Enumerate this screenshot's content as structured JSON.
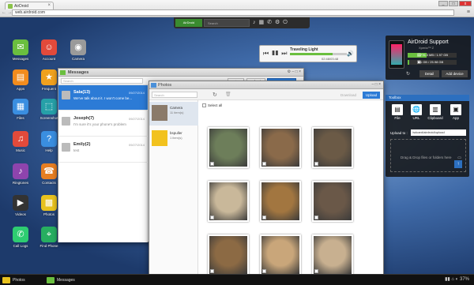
{
  "browser": {
    "tab_title": "AirDroid",
    "url": "web.airdroid.com",
    "nav_icons": "← → ↻",
    "menu_icon": "≡",
    "win_min": "_",
    "win_max": "□",
    "win_close": "x"
  },
  "topbar": {
    "logo": "AirDroid",
    "search_placeholder": "Search",
    "icons": [
      "bell-icon",
      "apps-icon",
      "phone-icon",
      "gear-icon",
      "power-icon"
    ]
  },
  "desktop_icons": [
    {
      "label": "Messages",
      "icon": "messages-icon",
      "color": "#6abf3f"
    },
    {
      "label": "Account",
      "icon": "account-icon",
      "color": "#e24a3b"
    },
    {
      "label": "Camera",
      "icon": "camera-icon",
      "color": "#9a9a9a"
    },
    {
      "label": "Apps",
      "icon": "apps-icon",
      "color": "#f28c1e"
    },
    {
      "label": "Frequent",
      "icon": "frequent-icon",
      "color": "#f0a11e"
    },
    {
      "label": "Files",
      "icon": "files-icon",
      "color": "#3a8ee0"
    },
    {
      "label": "Screenshot",
      "icon": "screenshot-icon",
      "color": "#26a0a8"
    },
    {
      "label": "Music",
      "icon": "music-icon",
      "color": "#e24a3b"
    },
    {
      "label": "Help",
      "icon": "help-icon",
      "color": "#3a8ee0"
    },
    {
      "label": "Ringtones",
      "icon": "ringtones-icon",
      "color": "#8e44ad"
    },
    {
      "label": "Contacts",
      "icon": "contacts-icon",
      "color": "#e67e22"
    },
    {
      "label": "Videos",
      "icon": "videos-icon",
      "color": "#333333"
    },
    {
      "label": "Photos",
      "icon": "photos-icon",
      "color": "#e8c21e"
    },
    {
      "label": "Call Logs",
      "icon": "calllogs-icon",
      "color": "#2ecc71"
    },
    {
      "label": "Find Phone",
      "icon": "findphone-icon",
      "color": "#27ae60"
    }
  ],
  "player": {
    "title": "Traveling Light",
    "time": "02:48/03:48",
    "progress": 0.75,
    "controls": "⏮ ❚❚ ⏭",
    "volume": "🔊"
  },
  "device": {
    "name": "AirDroid Support",
    "model": "Xperia™ Z",
    "storage_internal": "776.3 MB / 1.97 GB",
    "storage_internal_fill": 0.39,
    "storage_sd": "1 GB / 25.98 GB",
    "storage_sd_fill": 0.04,
    "refresh": "↻",
    "detail_label": "Detail",
    "add_label": "Add device"
  },
  "toolbox": {
    "title": "Toolbox",
    "tools": [
      {
        "label": "File",
        "icon": "file-icon"
      },
      {
        "label": "URL",
        "icon": "url-icon"
      },
      {
        "label": "Clipboard",
        "icon": "clipboard-icon"
      },
      {
        "label": "App",
        "icon": "app-icon"
      }
    ],
    "upload_to": "Upload to :",
    "upload_path": "/sdcard/airdroid/upload",
    "drop_text": "Drag & Drop files or folders here"
  },
  "messages_window": {
    "title": "Messages",
    "window_tools": "⚙ – □ ×",
    "search_placeholder": "Search",
    "delete_label": "Delete",
    "refresh_label": "Refresh",
    "new_message_label": "New Message",
    "conversations": [
      {
        "name": "Sala(13)",
        "date": "09/27/2014",
        "preview": "We've talk about it. I won't come be...",
        "active": true
      },
      {
        "name": "Joseph(7)",
        "date": "09/27/2014",
        "preview": "I'm sure it's your phone's problem",
        "active": false
      },
      {
        "name": "Emily(2)",
        "date": "09/27/2014",
        "preview": "test",
        "active": false
      }
    ]
  },
  "photos_window": {
    "title": "Photos",
    "window_tools": "– □ ×",
    "search_placeholder": "Search",
    "download_label": "Download",
    "upload_label": "Upload",
    "select_all": "Select all",
    "albums": [
      {
        "name": "Camera",
        "count": "11 item(s)",
        "active": true,
        "color": "#8a7a6a"
      },
      {
        "name": "bspuller",
        "count": "1 item(s)",
        "active": false,
        "color": "#f2c21e"
      }
    ],
    "photo_colors": [
      "#6d7e5a",
      "#8a6a4a",
      "#6b5a46",
      "#c9b89a",
      "#a27640",
      "#6a5848",
      "#8c6a44",
      "#c9a67a",
      "#c8b090"
    ]
  },
  "dock": {
    "items": [
      {
        "label": "Photos",
        "color": "#e8c21e"
      },
      {
        "label": "Messages",
        "color": "#6abf3f"
      }
    ],
    "tray": "▮▮ ⌂ ◐ 37%"
  }
}
